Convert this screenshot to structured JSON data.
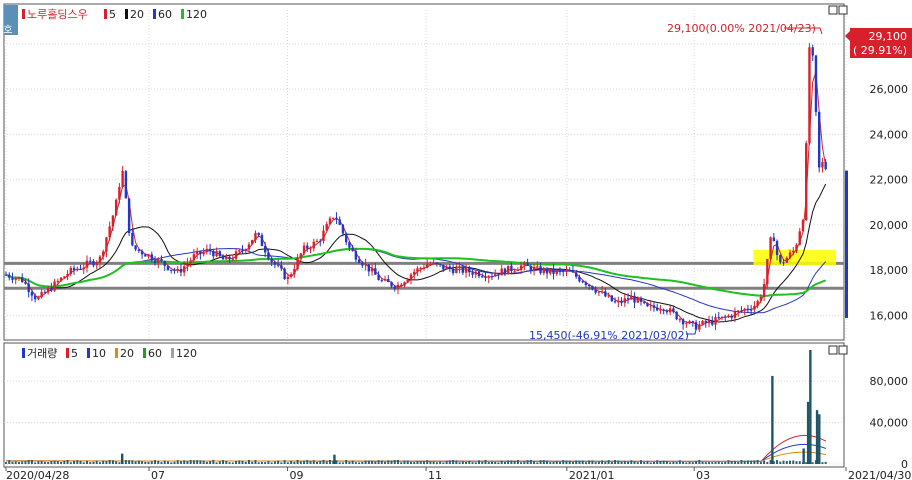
{
  "price_legend": {
    "tab": "호",
    "name": "노루홀딩스우",
    "ma": [
      {
        "label": "5",
        "color": "#d8202c"
      },
      {
        "label": "20",
        "color": "#111111"
      },
      {
        "label": "60",
        "color": "#2438c8"
      },
      {
        "label": "120",
        "color": "#20c020"
      }
    ]
  },
  "volume_legend": {
    "name": "거래량",
    "ma": [
      {
        "label": "5",
        "color": "#d8202c"
      },
      {
        "label": "10",
        "color": "#2438c8"
      },
      {
        "label": "20",
        "color": "#e08a10"
      },
      {
        "label": "60",
        "color": "#20a020"
      },
      {
        "label": "120",
        "color": "#a0a0a0"
      }
    ]
  },
  "annotations": {
    "high": "29,100(0.00% 2021/04/23)",
    "low": "15,450(-46.91% 2021/03/02)",
    "last_price": "29,100",
    "last_change": "( 29.91%)"
  },
  "colors": {
    "up": "#d8202c",
    "down": "#1f38c8",
    "highlight": "#ffff00",
    "hline": "#808080",
    "bg": "#ffffff"
  },
  "chart_data": [
    {
      "type": "candlestick",
      "title": "노루홀딩스우",
      "ylim": [
        15000,
        29500
      ],
      "y_ticks": [
        16000,
        18000,
        20000,
        22000,
        24000,
        26000,
        28000
      ],
      "y_tick_labels": [
        "16,000",
        "18,000",
        "20,000",
        "22,000",
        "24,000",
        "26,000",
        "28,000"
      ],
      "x_ticks": [
        "2020/04/28",
        "07",
        "09",
        "11",
        "2021/01",
        "03",
        "2021/04/30"
      ],
      "horizontal_lines": [
        18300,
        17200
      ],
      "highlight_zone": [
        18200,
        18900
      ],
      "close_series": [
        [
          "2020-04-28",
          17800
        ],
        [
          "2020-05-05",
          17600
        ],
        [
          "2020-05-12",
          16700
        ],
        [
          "2020-05-19",
          17300
        ],
        [
          "2020-05-26",
          17900
        ],
        [
          "2020-06-02",
          18200
        ],
        [
          "2020-06-09",
          18500
        ],
        [
          "2020-06-16",
          20800
        ],
        [
          "2020-06-19",
          22500
        ],
        [
          "2020-06-23",
          19000
        ],
        [
          "2020-06-30",
          18700
        ],
        [
          "2020-07-07",
          18300
        ],
        [
          "2020-07-14",
          17900
        ],
        [
          "2020-07-21",
          18600
        ],
        [
          "2020-07-28",
          18900
        ],
        [
          "2020-08-04",
          18400
        ],
        [
          "2020-08-11",
          18800
        ],
        [
          "2020-08-18",
          19600
        ],
        [
          "2020-08-25",
          18400
        ],
        [
          "2020-09-01",
          17600
        ],
        [
          "2020-09-08",
          18900
        ],
        [
          "2020-09-15",
          19300
        ],
        [
          "2020-09-22",
          20500
        ],
        [
          "2020-09-29",
          18900
        ],
        [
          "2020-10-06",
          18200
        ],
        [
          "2020-10-13",
          17500
        ],
        [
          "2020-10-20",
          17300
        ],
        [
          "2020-10-27",
          17900
        ],
        [
          "2020-11-03",
          18300
        ],
        [
          "2020-11-10",
          18100
        ],
        [
          "2020-11-17",
          18000
        ],
        [
          "2020-11-24",
          17900
        ],
        [
          "2020-12-01",
          17800
        ],
        [
          "2020-12-08",
          18000
        ],
        [
          "2020-12-15",
          18200
        ],
        [
          "2020-12-22",
          18000
        ],
        [
          "2020-12-29",
          17900
        ],
        [
          "2021-01-05",
          17900
        ],
        [
          "2021-01-12",
          17500
        ],
        [
          "2021-01-19",
          17000
        ],
        [
          "2021-01-26",
          16500
        ],
        [
          "2021-02-02",
          16800
        ],
        [
          "2021-02-09",
          16300
        ],
        [
          "2021-02-16",
          16400
        ],
        [
          "2021-02-23",
          15900
        ],
        [
          "2021-03-02",
          15500
        ],
        [
          "2021-03-09",
          15700
        ],
        [
          "2021-03-16",
          15900
        ],
        [
          "2021-03-23",
          16200
        ],
        [
          "2021-03-30",
          16500
        ],
        [
          "2021-04-02",
          17200
        ],
        [
          "2021-04-06",
          19800
        ],
        [
          "2021-04-09",
          18200
        ],
        [
          "2021-04-13",
          18600
        ],
        [
          "2021-04-16",
          18900
        ],
        [
          "2021-04-20",
          20500
        ],
        [
          "2021-04-21",
          23000
        ],
        [
          "2021-04-22",
          26000
        ],
        [
          "2021-04-23",
          29100
        ],
        [
          "2021-04-26",
          24000
        ],
        [
          "2021-04-27",
          22400
        ],
        [
          "2021-04-28",
          22400
        ],
        [
          "2021-04-29",
          23200
        ],
        [
          "2021-04-30",
          22400
        ]
      ]
    },
    {
      "type": "bar",
      "title": "거래량",
      "ylim": [
        0,
        110000
      ],
      "y_ticks": [
        0,
        40000,
        80000
      ],
      "y_tick_labels": [
        "0",
        "40,000",
        "80,000"
      ],
      "x": [
        "2020-06-19",
        "2020-09-22",
        "2021-04-06",
        "2021-04-20",
        "2021-04-22",
        "2021-04-23",
        "2021-04-26",
        "2021-04-27"
      ],
      "values": [
        10000,
        9000,
        85000,
        15000,
        60000,
        110000,
        52000,
        48000
      ]
    }
  ]
}
